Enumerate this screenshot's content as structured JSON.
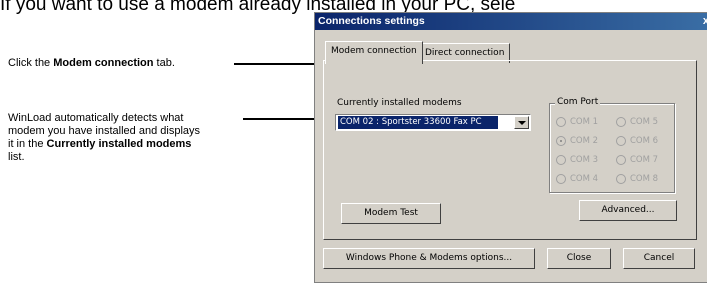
{
  "caption": "If you want to use a modem already installed in your PC, sele",
  "annotations": {
    "a1_prefix": "Click the ",
    "a1_bold": "Modem connection",
    "a1_suffix": " tab.",
    "a2_line1": "WinLoad automatically detects what",
    "a2_line2": "modem you have installed and displays",
    "a2_line3_prefix": "it in the ",
    "a2_line3_bold": "Currently installed modems",
    "a2_line4": "list."
  },
  "dialog": {
    "title": "Connections settings",
    "close_glyph": "x",
    "tabs": [
      "Modem connection",
      "Direct connection"
    ],
    "modems_label": "Currently installed modems",
    "selected_modem": "COM 02 : Sportster 33600 Fax PC",
    "com_port_label": "Com Port",
    "com_ports": [
      "COM 1",
      "COM 2",
      "COM 3",
      "COM 4",
      "COM 5",
      "COM 6",
      "COM 7",
      "COM 8"
    ],
    "com_selected": "COM 2",
    "modem_test": "Modem Test",
    "advanced": "Advanced...",
    "windows_phone": "Windows Phone & Modems options...",
    "close": "Close",
    "cancel": "Cancel"
  }
}
